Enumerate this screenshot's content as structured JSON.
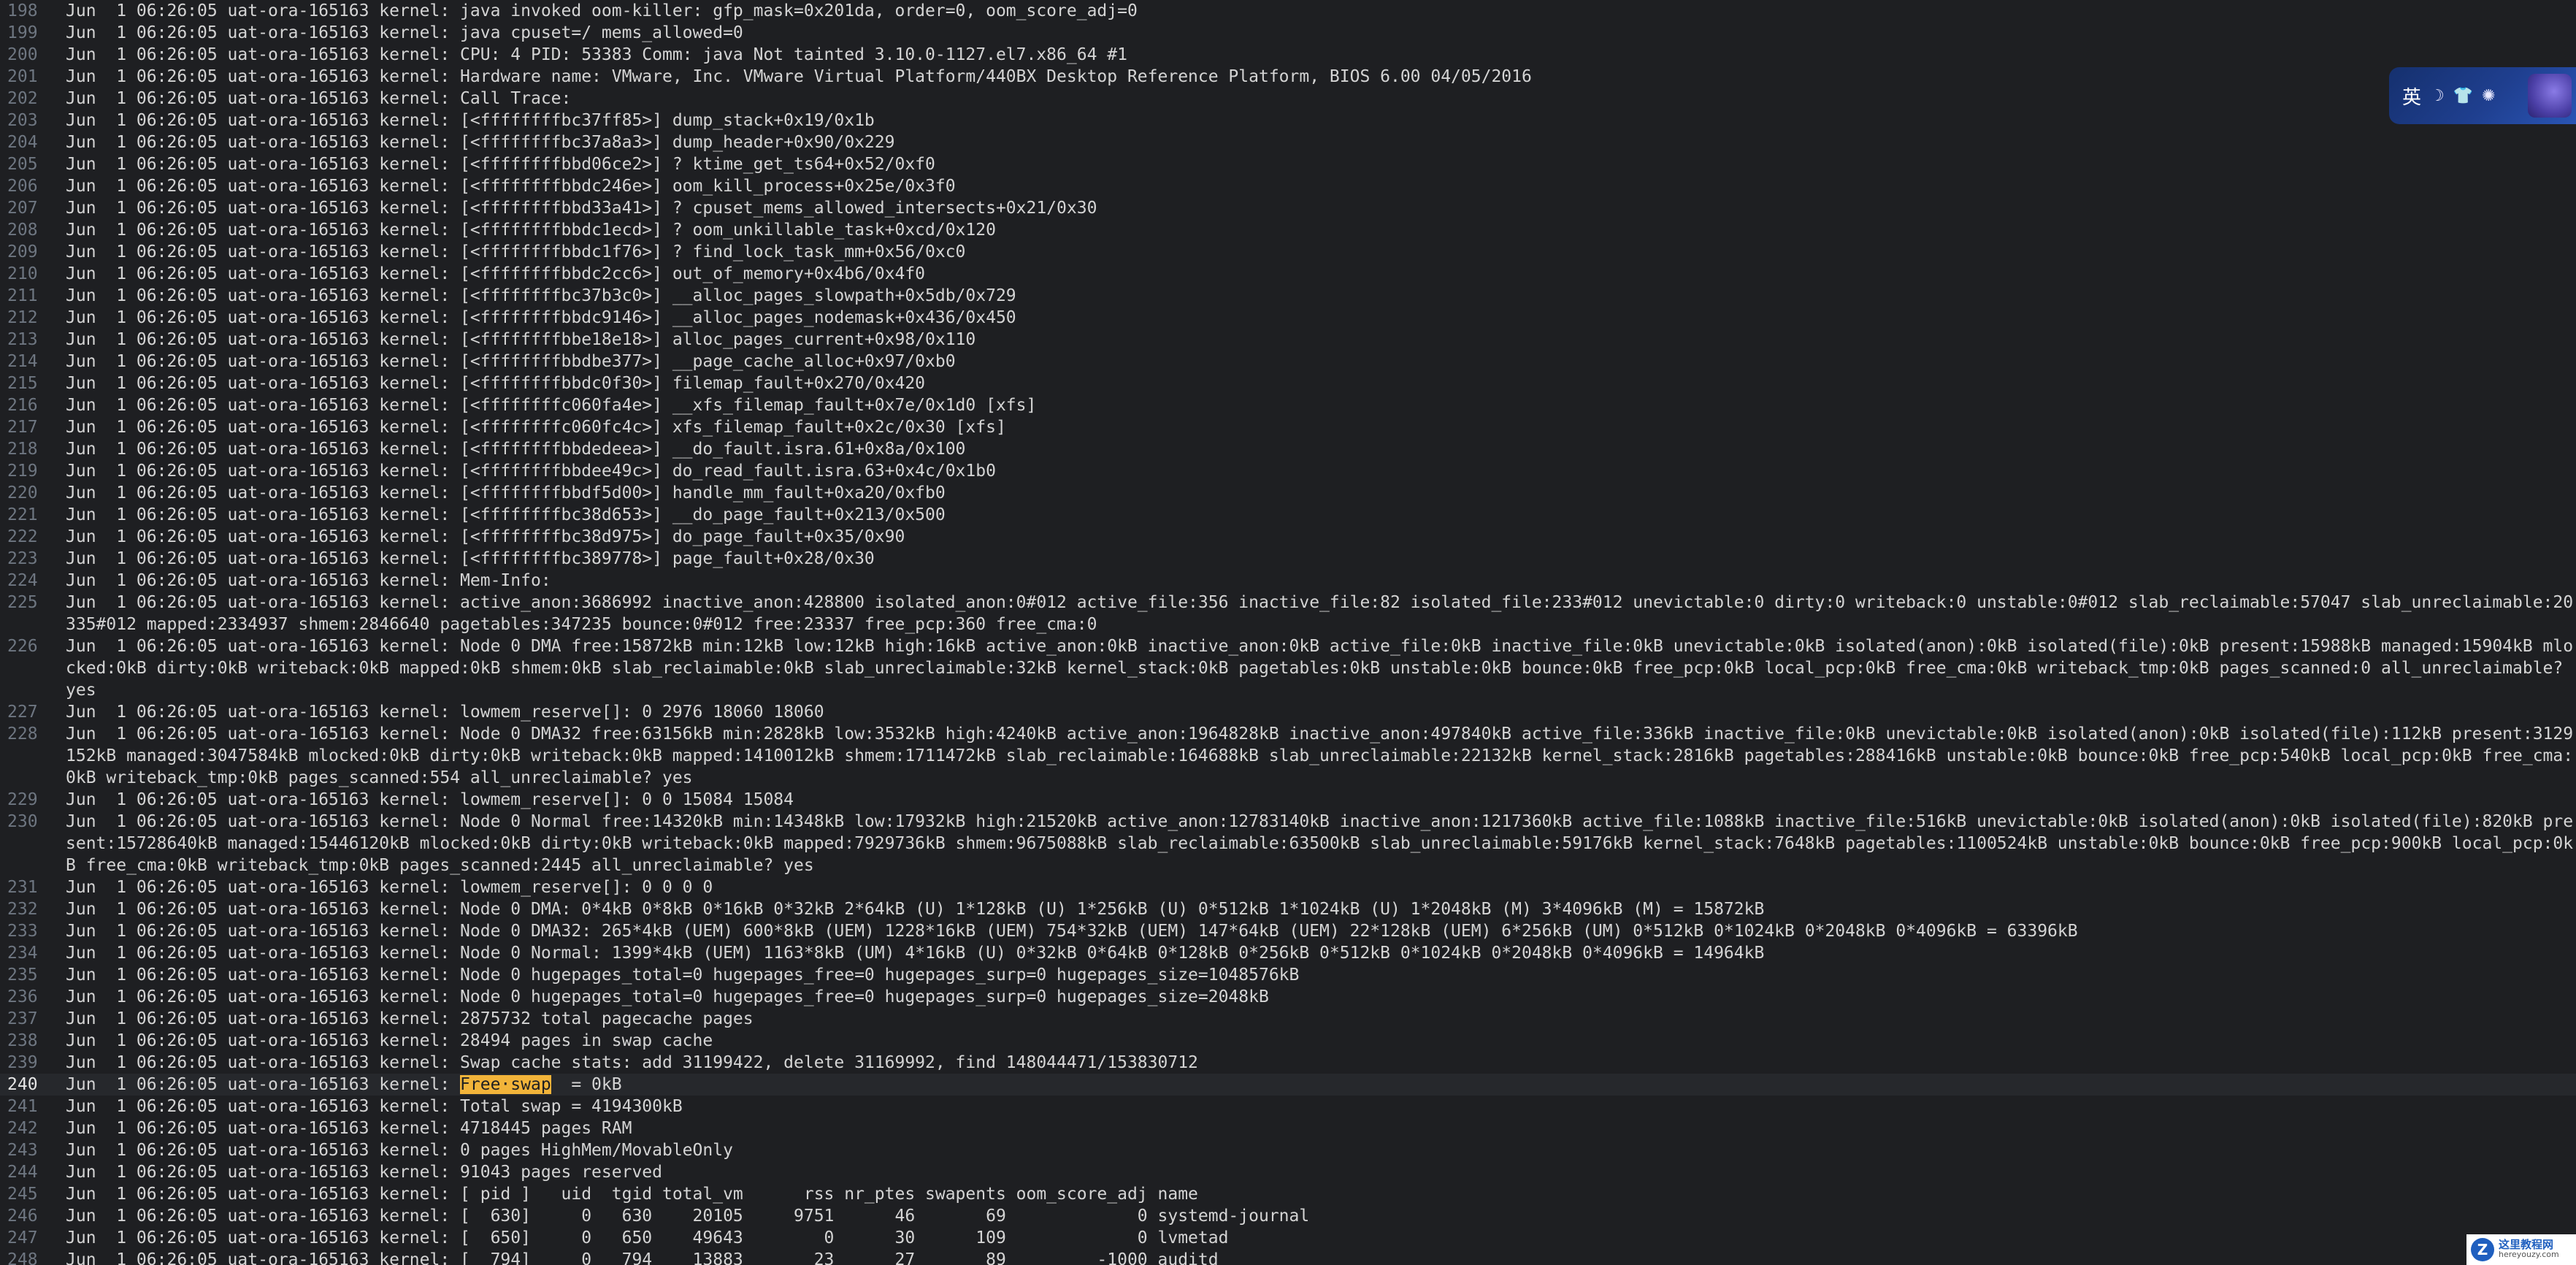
{
  "editor": {
    "current_line": "240",
    "highlight": {
      "line": "240",
      "text": "Free·swap"
    },
    "lines": [
      {
        "n": "198",
        "text": "Jun  1 06:26:05 uat-ora-165163 kernel: java invoked oom-killer: gfp_mask=0x201da, order=0, oom_score_adj=0"
      },
      {
        "n": "199",
        "text": "Jun  1 06:26:05 uat-ora-165163 kernel: java cpuset=/ mems_allowed=0"
      },
      {
        "n": "200",
        "text": "Jun  1 06:26:05 uat-ora-165163 kernel: CPU: 4 PID: 53383 Comm: java Not tainted 3.10.0-1127.el7.x86_64 #1"
      },
      {
        "n": "201",
        "text": "Jun  1 06:26:05 uat-ora-165163 kernel: Hardware name: VMware, Inc. VMware Virtual Platform/440BX Desktop Reference Platform, BIOS 6.00 04/05/2016"
      },
      {
        "n": "202",
        "text": "Jun  1 06:26:05 uat-ora-165163 kernel: Call Trace:"
      },
      {
        "n": "203",
        "text": "Jun  1 06:26:05 uat-ora-165163 kernel: [<ffffffffbc37ff85>] dump_stack+0x19/0x1b"
      },
      {
        "n": "204",
        "text": "Jun  1 06:26:05 uat-ora-165163 kernel: [<ffffffffbc37a8a3>] dump_header+0x90/0x229"
      },
      {
        "n": "205",
        "text": "Jun  1 06:26:05 uat-ora-165163 kernel: [<ffffffffbbd06ce2>] ? ktime_get_ts64+0x52/0xf0"
      },
      {
        "n": "206",
        "text": "Jun  1 06:26:05 uat-ora-165163 kernel: [<ffffffffbbdc246e>] oom_kill_process+0x25e/0x3f0"
      },
      {
        "n": "207",
        "text": "Jun  1 06:26:05 uat-ora-165163 kernel: [<ffffffffbbd33a41>] ? cpuset_mems_allowed_intersects+0x21/0x30"
      },
      {
        "n": "208",
        "text": "Jun  1 06:26:05 uat-ora-165163 kernel: [<ffffffffbbdc1ecd>] ? oom_unkillable_task+0xcd/0x120"
      },
      {
        "n": "209",
        "text": "Jun  1 06:26:05 uat-ora-165163 kernel: [<ffffffffbbdc1f76>] ? find_lock_task_mm+0x56/0xc0"
      },
      {
        "n": "210",
        "text": "Jun  1 06:26:05 uat-ora-165163 kernel: [<ffffffffbbdc2cc6>] out_of_memory+0x4b6/0x4f0"
      },
      {
        "n": "211",
        "text": "Jun  1 06:26:05 uat-ora-165163 kernel: [<ffffffffbc37b3c0>] __alloc_pages_slowpath+0x5db/0x729"
      },
      {
        "n": "212",
        "text": "Jun  1 06:26:05 uat-ora-165163 kernel: [<ffffffffbbdc9146>] __alloc_pages_nodemask+0x436/0x450"
      },
      {
        "n": "213",
        "text": "Jun  1 06:26:05 uat-ora-165163 kernel: [<ffffffffbbe18e18>] alloc_pages_current+0x98/0x110"
      },
      {
        "n": "214",
        "text": "Jun  1 06:26:05 uat-ora-165163 kernel: [<ffffffffbbdbe377>] __page_cache_alloc+0x97/0xb0"
      },
      {
        "n": "215",
        "text": "Jun  1 06:26:05 uat-ora-165163 kernel: [<ffffffffbbdc0f30>] filemap_fault+0x270/0x420"
      },
      {
        "n": "216",
        "text": "Jun  1 06:26:05 uat-ora-165163 kernel: [<ffffffffc060fa4e>] __xfs_filemap_fault+0x7e/0x1d0 [xfs]"
      },
      {
        "n": "217",
        "text": "Jun  1 06:26:05 uat-ora-165163 kernel: [<ffffffffc060fc4c>] xfs_filemap_fault+0x2c/0x30 [xfs]"
      },
      {
        "n": "218",
        "text": "Jun  1 06:26:05 uat-ora-165163 kernel: [<ffffffffbbdedeea>] __do_fault.isra.61+0x8a/0x100"
      },
      {
        "n": "219",
        "text": "Jun  1 06:26:05 uat-ora-165163 kernel: [<ffffffffbbdee49c>] do_read_fault.isra.63+0x4c/0x1b0"
      },
      {
        "n": "220",
        "text": "Jun  1 06:26:05 uat-ora-165163 kernel: [<ffffffffbbdf5d00>] handle_mm_fault+0xa20/0xfb0"
      },
      {
        "n": "221",
        "text": "Jun  1 06:26:05 uat-ora-165163 kernel: [<ffffffffbc38d653>] __do_page_fault+0x213/0x500"
      },
      {
        "n": "222",
        "text": "Jun  1 06:26:05 uat-ora-165163 kernel: [<ffffffffbc38d975>] do_page_fault+0x35/0x90"
      },
      {
        "n": "223",
        "text": "Jun  1 06:26:05 uat-ora-165163 kernel: [<ffffffffbc389778>] page_fault+0x28/0x30"
      },
      {
        "n": "224",
        "text": "Jun  1 06:26:05 uat-ora-165163 kernel: Mem-Info:"
      },
      {
        "n": "225",
        "text": "Jun  1 06:26:05 uat-ora-165163 kernel: active_anon:3686992 inactive_anon:428800 isolated_anon:0#012 active_file:356 inactive_file:82 isolated_file:233#012 unevictable:0 dirty:0 writeback:0 unstable:0#012 slab_reclaimable:57047 slab_unreclaimable:20335#012 mapped:2334937 shmem:2846640 pagetables:347235 bounce:0#012 free:23337 free_pcp:360 free_cma:0"
      },
      {
        "n": "226",
        "text": "Jun  1 06:26:05 uat-ora-165163 kernel: Node 0 DMA free:15872kB min:12kB low:12kB high:16kB active_anon:0kB inactive_anon:0kB active_file:0kB inactive_file:0kB unevictable:0kB isolated(anon):0kB isolated(file):0kB present:15988kB managed:15904kB mlocked:0kB dirty:0kB writeback:0kB mapped:0kB shmem:0kB slab_reclaimable:0kB slab_unreclaimable:32kB kernel_stack:0kB pagetables:0kB unstable:0kB bounce:0kB free_pcp:0kB local_pcp:0kB free_cma:0kB writeback_tmp:0kB pages_scanned:0 all_unreclaimable? yes"
      },
      {
        "n": "227",
        "text": "Jun  1 06:26:05 uat-ora-165163 kernel: lowmem_reserve[]: 0 2976 18060 18060"
      },
      {
        "n": "228",
        "text": "Jun  1 06:26:05 uat-ora-165163 kernel: Node 0 DMA32 free:63156kB min:2828kB low:3532kB high:4240kB active_anon:1964828kB inactive_anon:497840kB active_file:336kB inactive_file:0kB unevictable:0kB isolated(anon):0kB isolated(file):112kB present:3129152kB managed:3047584kB mlocked:0kB dirty:0kB writeback:0kB mapped:1410012kB shmem:1711472kB slab_reclaimable:164688kB slab_unreclaimable:22132kB kernel_stack:2816kB pagetables:288416kB unstable:0kB bounce:0kB free_pcp:540kB local_pcp:0kB free_cma:0kB writeback_tmp:0kB pages_scanned:554 all_unreclaimable? yes"
      },
      {
        "n": "229",
        "text": "Jun  1 06:26:05 uat-ora-165163 kernel: lowmem_reserve[]: 0 0 15084 15084"
      },
      {
        "n": "230",
        "text": "Jun  1 06:26:05 uat-ora-165163 kernel: Node 0 Normal free:14320kB min:14348kB low:17932kB high:21520kB active_anon:12783140kB inactive_anon:1217360kB active_file:1088kB inactive_file:516kB unevictable:0kB isolated(anon):0kB isolated(file):820kB present:15728640kB managed:15446120kB mlocked:0kB dirty:0kB writeback:0kB mapped:7929736kB shmem:9675088kB slab_reclaimable:63500kB slab_unreclaimable:59176kB kernel_stack:7648kB pagetables:1100524kB unstable:0kB bounce:0kB free_pcp:900kB local_pcp:0kB free_cma:0kB writeback_tmp:0kB pages_scanned:2445 all_unreclaimable? yes"
      },
      {
        "n": "231",
        "text": "Jun  1 06:26:05 uat-ora-165163 kernel: lowmem_reserve[]: 0 0 0 0"
      },
      {
        "n": "232",
        "text": "Jun  1 06:26:05 uat-ora-165163 kernel: Node 0 DMA: 0*4kB 0*8kB 0*16kB 0*32kB 2*64kB (U) 1*128kB (U) 1*256kB (U) 0*512kB 1*1024kB (U) 1*2048kB (M) 3*4096kB (M) = 15872kB"
      },
      {
        "n": "233",
        "text": "Jun  1 06:26:05 uat-ora-165163 kernel: Node 0 DMA32: 265*4kB (UEM) 600*8kB (UEM) 1228*16kB (UEM) 754*32kB (UEM) 147*64kB (UEM) 22*128kB (UEM) 6*256kB (UM) 0*512kB 0*1024kB 0*2048kB 0*4096kB = 63396kB"
      },
      {
        "n": "234",
        "text": "Jun  1 06:26:05 uat-ora-165163 kernel: Node 0 Normal: 1399*4kB (UEM) 1163*8kB (UM) 4*16kB (U) 0*32kB 0*64kB 0*128kB 0*256kB 0*512kB 0*1024kB 0*2048kB 0*4096kB = 14964kB"
      },
      {
        "n": "235",
        "text": "Jun  1 06:26:05 uat-ora-165163 kernel: Node 0 hugepages_total=0 hugepages_free=0 hugepages_surp=0 hugepages_size=1048576kB"
      },
      {
        "n": "236",
        "text": "Jun  1 06:26:05 uat-ora-165163 kernel: Node 0 hugepages_total=0 hugepages_free=0 hugepages_surp=0 hugepages_size=2048kB"
      },
      {
        "n": "237",
        "text": "Jun  1 06:26:05 uat-ora-165163 kernel: 2875732 total pagecache pages"
      },
      {
        "n": "238",
        "text": "Jun  1 06:26:05 uat-ora-165163 kernel: 28494 pages in swap cache"
      },
      {
        "n": "239",
        "text": "Jun  1 06:26:05 uat-ora-165163 kernel: Swap cache stats: add 31199422, delete 31169992, find 148044471/153830712"
      },
      {
        "n": "240",
        "text": "Jun  1 06:26:05 uat-ora-165163 kernel: Free·swap  = 0kB"
      },
      {
        "n": "241",
        "text": "Jun  1 06:26:05 uat-ora-165163 kernel: Total swap = 4194300kB"
      },
      {
        "n": "242",
        "text": "Jun  1 06:26:05 uat-ora-165163 kernel: 4718445 pages RAM"
      },
      {
        "n": "243",
        "text": "Jun  1 06:26:05 uat-ora-165163 kernel: 0 pages HighMem/MovableOnly"
      },
      {
        "n": "244",
        "text": "Jun  1 06:26:05 uat-ora-165163 kernel: 91043 pages reserved"
      },
      {
        "n": "245",
        "text": "Jun  1 06:26:05 uat-ora-165163 kernel: [ pid ]   uid  tgid total_vm      rss nr_ptes swapents oom_score_adj name"
      },
      {
        "n": "246",
        "text": "Jun  1 06:26:05 uat-ora-165163 kernel: [  630]     0   630    20105     9751      46       69             0 systemd-journal"
      },
      {
        "n": "247",
        "text": "Jun  1 06:26:05 uat-ora-165163 kernel: [  650]     0   650    49643        0      30      109             0 lvmetad"
      },
      {
        "n": "248",
        "text": "Jun  1 06:26:05 uat-ora-165163 kernel: [  794]     0   794    13883       23      27       89         -1000 auditd"
      }
    ]
  },
  "ime": {
    "label": "英",
    "icons": [
      "moon-icon",
      "shirt-icon",
      "settings-icon",
      "cat-mascot-icon"
    ],
    "moon_glyph": "☽",
    "shirt_glyph": "👕",
    "gear_glyph": "✺"
  },
  "watermark": {
    "logo_text": "Z",
    "brand": "这里教程网",
    "url": "hereyouzy.com"
  },
  "colors": {
    "background": "#1e1f22",
    "text": "#d4d4d4",
    "gutter": "#6e7681",
    "highlight": "#f2b43a"
  }
}
